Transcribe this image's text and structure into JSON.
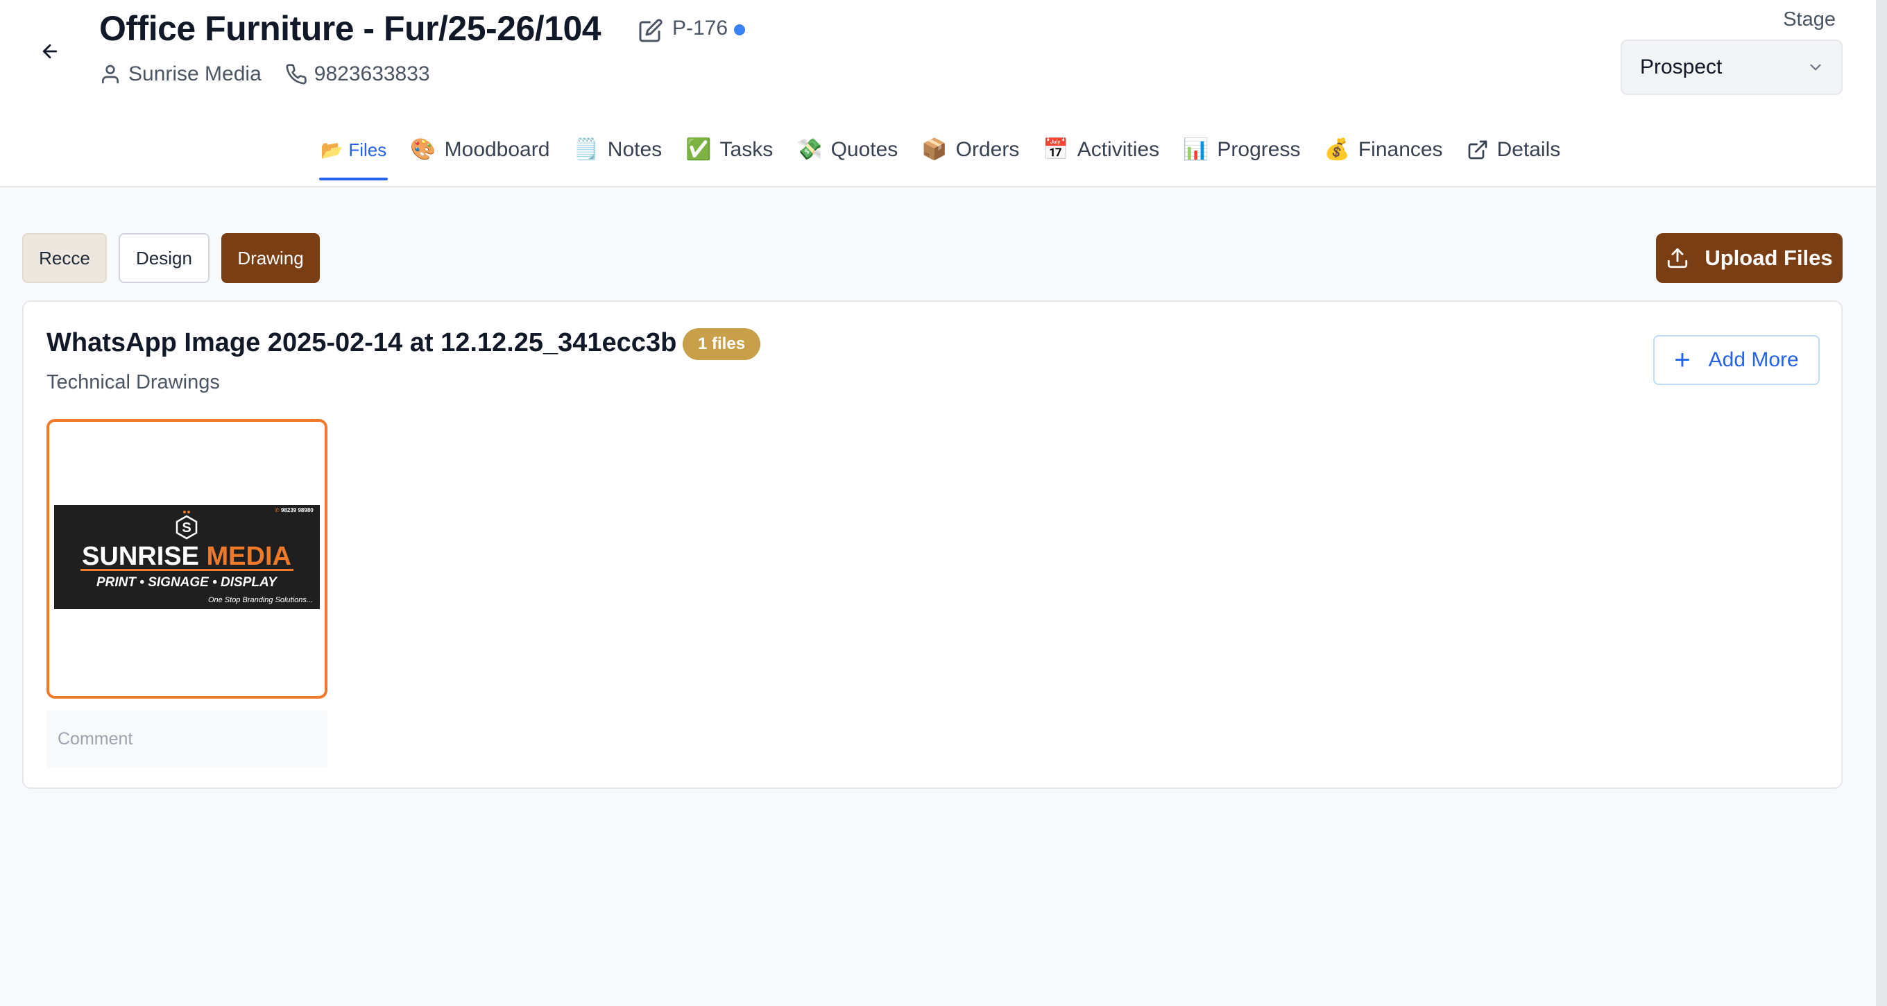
{
  "header": {
    "title": "Office Furniture - Fur/25-26/104",
    "project_code": "P-176",
    "client_name": "Sunrise Media",
    "phone": "9823633833",
    "status_dot_color": "#3b82f6"
  },
  "stage": {
    "label": "Stage",
    "selected": "Prospect"
  },
  "tabs": [
    {
      "icon": "📂",
      "label": "Files",
      "active": true
    },
    {
      "icon": "🎨",
      "label": "Moodboard"
    },
    {
      "icon": "🗒️",
      "label": "Notes"
    },
    {
      "icon": "✅",
      "label": "Tasks"
    },
    {
      "icon": "💸",
      "label": "Quotes"
    },
    {
      "icon": "📦",
      "label": "Orders"
    },
    {
      "icon": "📅",
      "label": "Activities"
    },
    {
      "icon": "📊",
      "label": "Progress"
    },
    {
      "icon": "💰",
      "label": "Finances"
    },
    {
      "icon": "external-link-icon",
      "label": "Details"
    }
  ],
  "filters": {
    "recce": "Recce",
    "design": "Design",
    "drawing": "Drawing",
    "active": "Drawing"
  },
  "upload_label": "Upload Files",
  "file_group": {
    "title": "WhatsApp Image 2025-02-14 at 12.12.25_341ecc3b",
    "count_badge": "1 files",
    "subtitle": "Technical Drawings",
    "add_more_label": "Add More",
    "comment_placeholder": "Comment"
  },
  "thumbnail": {
    "brand_left": "SUNRISE",
    "brand_right": "MEDIA",
    "tagline": "PRINT • SIGNAGE • DISPLAY",
    "slogan": "One Stop Branding Solutions...",
    "phone": "98239 98980"
  },
  "colors": {
    "accent_brown": "#7a3e15",
    "accent_blue": "#2563eb",
    "badge_gold": "#c9a04a",
    "thumb_border": "#f07a2c",
    "brand_orange": "#ef7a2a"
  }
}
